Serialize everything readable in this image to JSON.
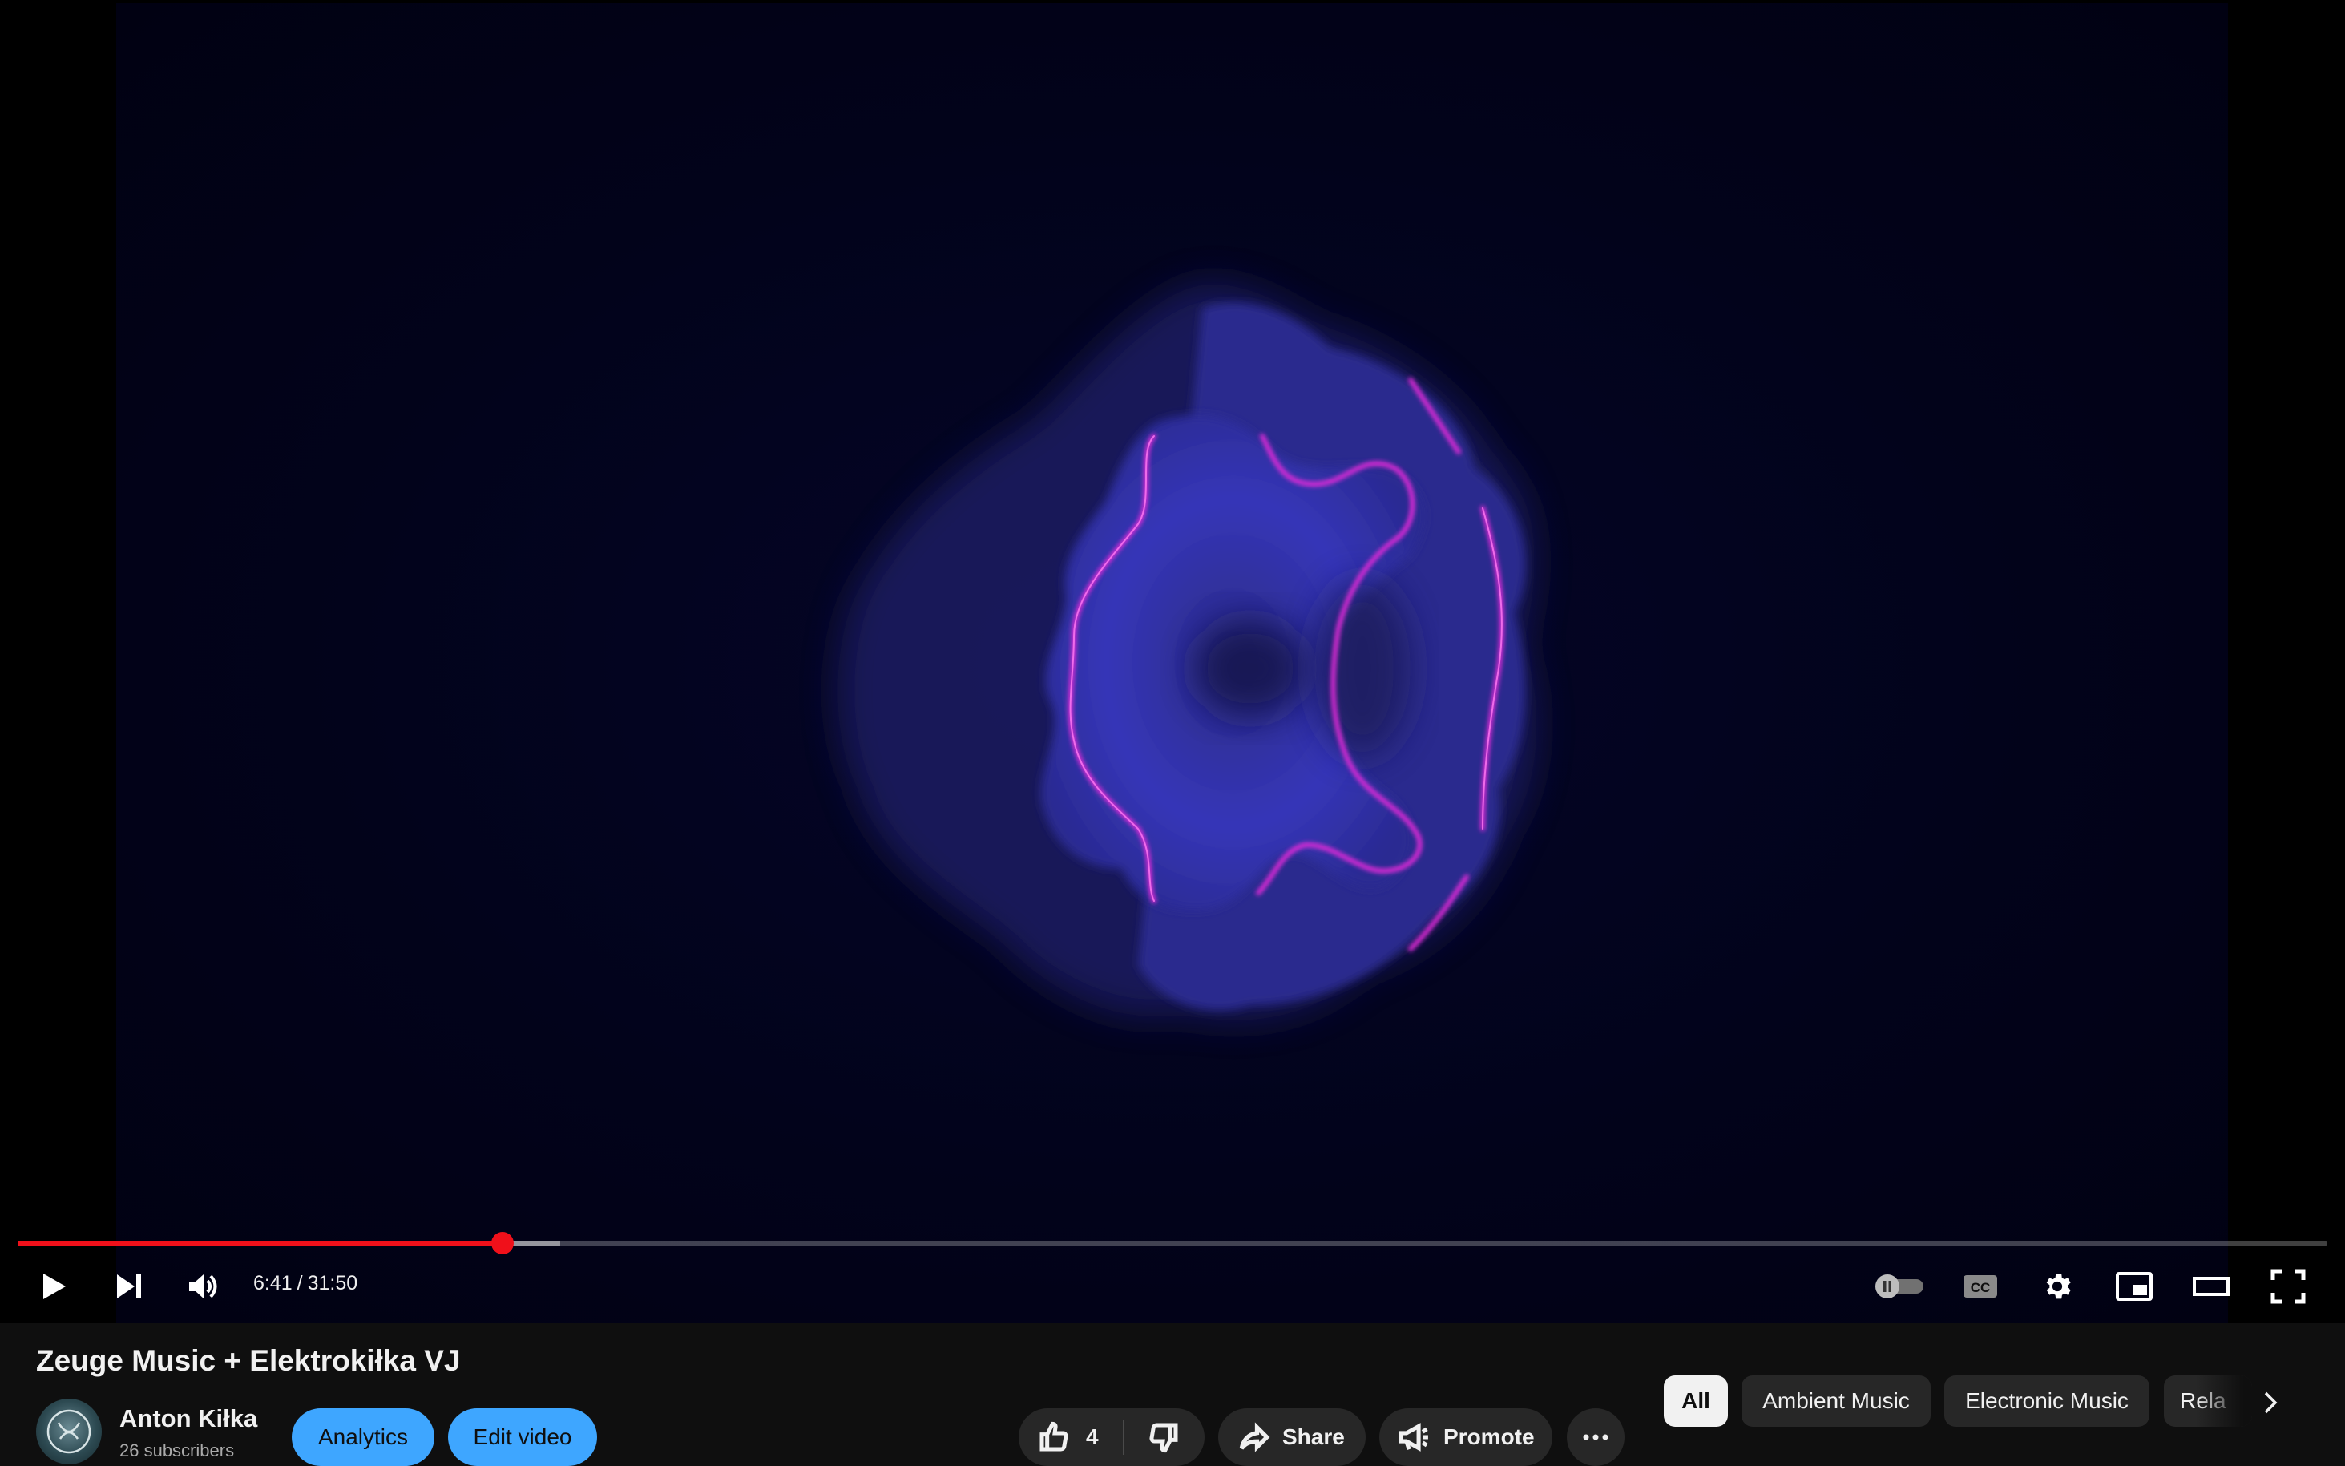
{
  "player": {
    "current_time": "6:41",
    "time_separator": "/",
    "duration": "31:50",
    "progress_fraction": 0.21,
    "buffered_fraction": 0.235,
    "progress_color": "#f0101a"
  },
  "controls": {
    "play": "play-icon",
    "next": "next-icon",
    "volume": "volume-icon",
    "autoplay": "autoplay-toggle-icon",
    "captions": "cc-icon",
    "settings": "gear-icon",
    "miniplayer": "miniplayer-icon",
    "theater": "theater-icon",
    "fullscreen": "fullscreen-icon"
  },
  "video_info": {
    "title": "Zeuge Music + Elektrokiłka VJ",
    "channel_name": "Anton Kiłka",
    "subscribers": "26 subscribers",
    "analytics_label": "Analytics",
    "edit_label": "Edit video",
    "like_count": "4",
    "share_label": "Share",
    "promote_label": "Promote"
  },
  "chips": [
    {
      "label": "All",
      "active": true
    },
    {
      "label": "Ambient Music",
      "active": false
    },
    {
      "label": "Electronic Music",
      "active": false
    },
    {
      "label": "Rela",
      "active": false
    }
  ],
  "colors": {
    "accent_blue": "#3ea6ff",
    "background": "#0f0f0f",
    "chip_bg": "#272727",
    "visual_glow": "#e02ad8"
  }
}
